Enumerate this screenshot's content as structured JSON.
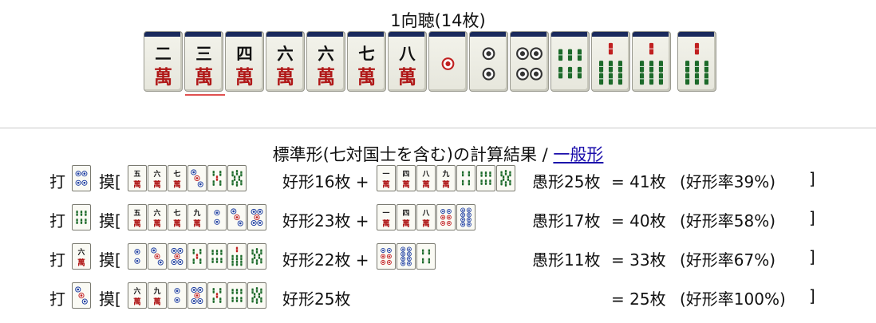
{
  "hand": {
    "title": "1向聴(14枚)",
    "tiles": [
      {
        "kind": "m",
        "num": "二"
      },
      {
        "kind": "m",
        "num": "三"
      },
      {
        "kind": "m",
        "num": "四"
      },
      {
        "kind": "m",
        "num": "六"
      },
      {
        "kind": "m",
        "num": "六"
      },
      {
        "kind": "m",
        "num": "七"
      },
      {
        "kind": "m",
        "num": "八"
      },
      {
        "kind": "p",
        "n": 1
      },
      {
        "kind": "p",
        "n": 2
      },
      {
        "kind": "p",
        "n": 4
      },
      {
        "kind": "s",
        "n": 6
      },
      {
        "kind": "s",
        "n": 7
      },
      {
        "kind": "s",
        "n": 7
      },
      {
        "kind": "s",
        "n": 7
      }
    ]
  },
  "result": {
    "title_prefix": "標準形(七対国士を含む)の計算結果 / ",
    "link": "一般形"
  },
  "labels": {
    "discard": "打",
    "draw": "摸["
  },
  "rows": [
    {
      "discard": {
        "kind": "p",
        "n": 4
      },
      "good": [
        {
          "kind": "m",
          "num": "五"
        },
        {
          "kind": "m",
          "num": "六"
        },
        {
          "kind": "m",
          "num": "七"
        },
        {
          "kind": "p",
          "n": 3
        },
        {
          "kind": "s",
          "n": 5
        },
        {
          "kind": "s",
          "n": 8
        }
      ],
      "good_text": "好形16枚 +",
      "bad": [
        {
          "kind": "m",
          "num": "一"
        },
        {
          "kind": "m",
          "num": "四"
        },
        {
          "kind": "m",
          "num": "八"
        },
        {
          "kind": "m",
          "num": "九"
        },
        {
          "kind": "s",
          "n": 4
        },
        {
          "kind": "s",
          "n": 6
        },
        {
          "kind": "s",
          "n": 8
        }
      ],
      "bad_text": "愚形25枚",
      "total": "= 41枚",
      "rate": "(好形率39%)",
      "close": "]"
    },
    {
      "discard": {
        "kind": "s",
        "n": 6
      },
      "good": [
        {
          "kind": "m",
          "num": "五"
        },
        {
          "kind": "m",
          "num": "六"
        },
        {
          "kind": "m",
          "num": "七"
        },
        {
          "kind": "m",
          "num": "九"
        },
        {
          "kind": "p",
          "n": 2
        },
        {
          "kind": "p",
          "n": 3
        },
        {
          "kind": "p",
          "n": 5
        }
      ],
      "good_text": "好形23枚 +",
      "bad": [
        {
          "kind": "m",
          "num": "一"
        },
        {
          "kind": "m",
          "num": "四"
        },
        {
          "kind": "m",
          "num": "八"
        },
        {
          "kind": "p",
          "n": 6
        },
        {
          "kind": "p",
          "n": 8
        }
      ],
      "bad_text": "愚形17枚",
      "total": "= 40枚",
      "rate": "(好形率58%)",
      "close": "]"
    },
    {
      "discard": {
        "kind": "m",
        "num": "六"
      },
      "good": [
        {
          "kind": "p",
          "n": 2
        },
        {
          "kind": "p",
          "n": 3
        },
        {
          "kind": "p",
          "n": 5
        },
        {
          "kind": "s",
          "n": 5
        },
        {
          "kind": "s",
          "n": 6
        },
        {
          "kind": "s",
          "n": 7
        },
        {
          "kind": "s",
          "n": 8
        }
      ],
      "good_text": "好形22枚 +",
      "bad": [
        {
          "kind": "p",
          "n": 6
        },
        {
          "kind": "p",
          "n": 8
        },
        {
          "kind": "s",
          "n": 4
        }
      ],
      "bad_text": "愚形11枚",
      "total": "= 33枚",
      "rate": "(好形率67%)",
      "close": "]"
    },
    {
      "discard": {
        "kind": "p",
        "n": 3
      },
      "good": [
        {
          "kind": "m",
          "num": "六"
        },
        {
          "kind": "m",
          "num": "九"
        },
        {
          "kind": "p",
          "n": 2
        },
        {
          "kind": "p",
          "n": 5
        },
        {
          "kind": "s",
          "n": 5
        },
        {
          "kind": "s",
          "n": 6
        },
        {
          "kind": "s",
          "n": 8
        }
      ],
      "good_text": "好形25枚",
      "bad": [],
      "bad_text": "",
      "total": "= 25枚",
      "rate": "(好形率100%)",
      "close": "]"
    }
  ]
}
